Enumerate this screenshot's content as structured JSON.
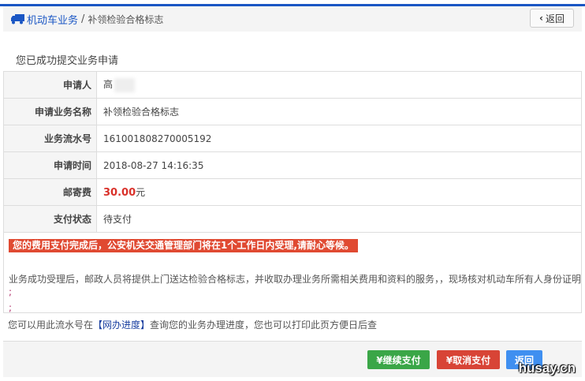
{
  "header": {
    "breadcrumb_link": "机动车业务",
    "separator": "/",
    "breadcrumb_current": "补领检验合格标志",
    "back_label": "返回"
  },
  "title": "您已成功提交业务申请",
  "rows": [
    {
      "label": "申请人",
      "value": "高"
    },
    {
      "label": "申请业务名称",
      "value": "补领检验合格标志"
    },
    {
      "label": "业务流水号",
      "value": "161001808270005192"
    },
    {
      "label": "申请时间",
      "value": "2018-08-27 14:16:35"
    },
    {
      "label": "邮寄费",
      "value": "30.00",
      "unit": "元"
    },
    {
      "label": "支付状态",
      "value": "待支付"
    }
  ],
  "info": {
    "alert": "您的费用支付完成后，公安机关交通管理部门将在1个工作日内受理,请耐心等候。",
    "desc": "业务成功受理后，邮政人员将提供上门送达检验合格标志，并收取办理业务所需相关费用和资料的服务，，现场核对机动车所有人身份证明",
    "semi": ";",
    "query_prefix": "您可以用此流水号在",
    "query_link": "【网办进度】",
    "query_suffix": "查询您的业务办理进度，您也可以打印此页方便日后查"
  },
  "footer": {
    "continue_pay": "¥继续支付",
    "cancel_pay": "¥取消支付",
    "back": "返回"
  },
  "watermark": "husay.cn"
}
